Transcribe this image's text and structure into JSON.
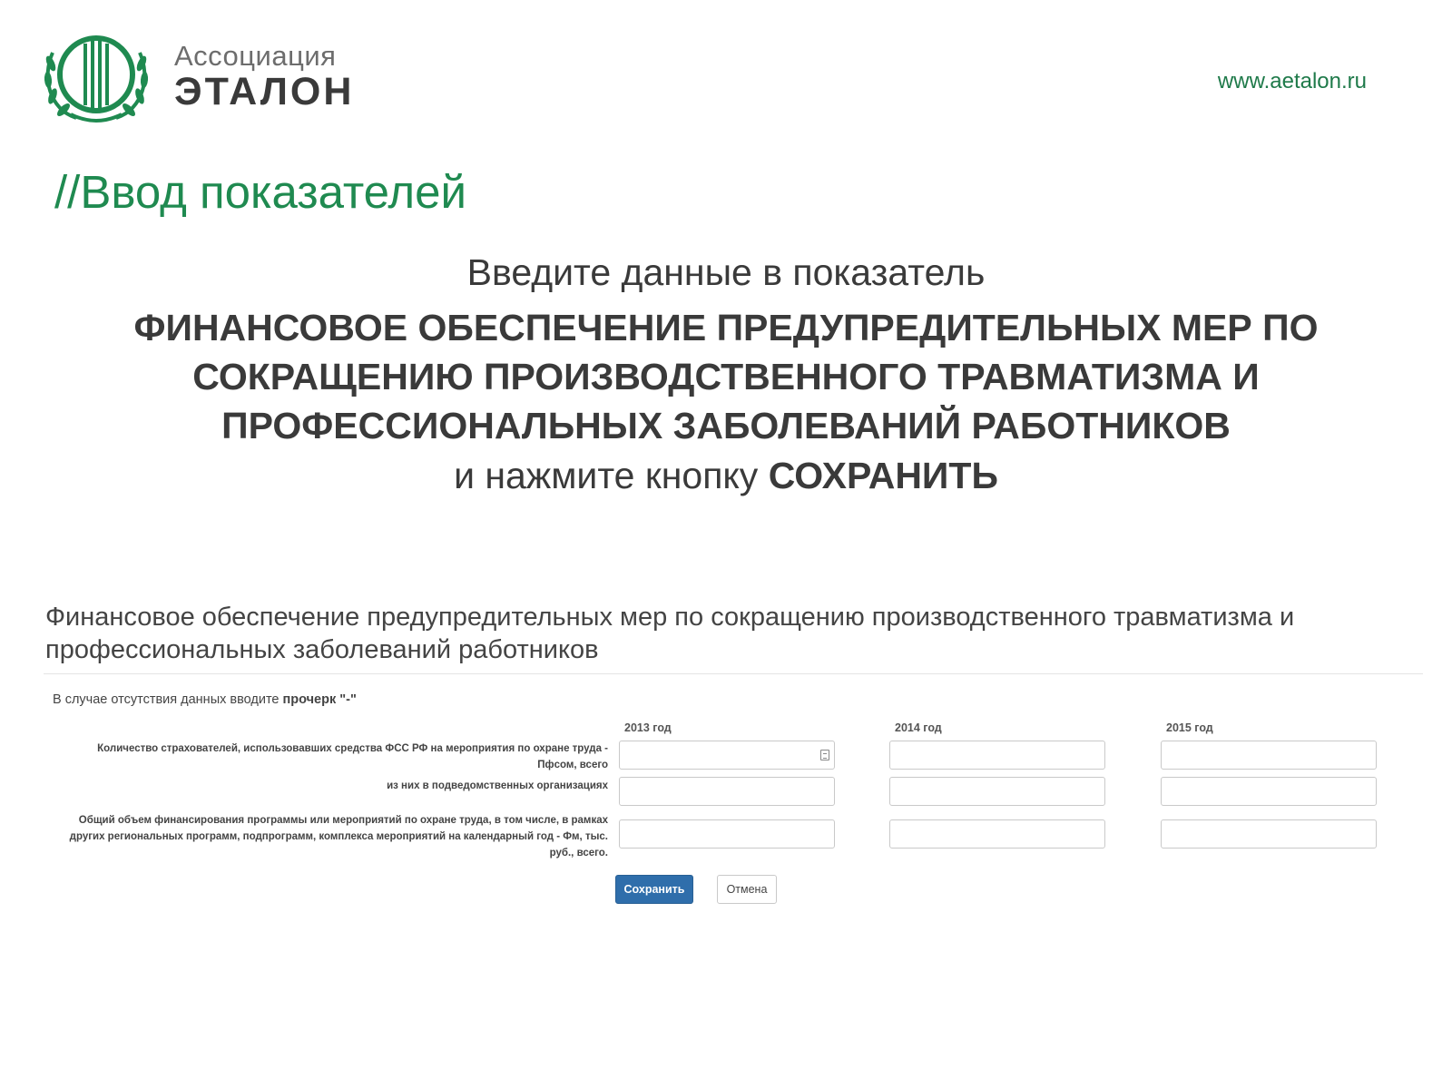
{
  "header": {
    "brand_line1": "Ассоциация",
    "brand_line2": "ЭТАЛОН",
    "site_url": "www.aetalon.ru",
    "logo_icon": "laurel-wreath-logo-icon",
    "brand_color": "#1f8a50"
  },
  "slide": {
    "title": "//Ввод показателей"
  },
  "instruction": {
    "lead": "Введите данные в показатель",
    "indicator": "ФИНАНСОВОЕ ОБЕСПЕЧЕНИЕ ПРЕДУПРЕДИТЕЛЬНЫХ МЕР ПО СОКРАЩЕНИЮ ПРОИЗВОДСТВЕННОГО ТРАВМАТИЗМА И ПРОФЕССИОНАЛЬНЫХ ЗАБОЛЕВАНИЙ РАБОТНИКОВ",
    "action_prefix": "и нажмите кнопку ",
    "action_button": "СОХРАНИТЬ"
  },
  "form": {
    "heading": "Финансовое обеспечение предупредительных мер по сокращению производственного травматизма и профессиональных заболеваний работников",
    "hint_prefix": "В случае отсутствия данных вводите ",
    "hint_bold": "прочерк \"-\"",
    "columns": [
      "2013 год",
      "2014 год",
      "2015 год"
    ],
    "rows": [
      {
        "label": "Количество страхователей, использовавших средства ФСС РФ на мероприятия по охране труда - Пфсом, всего",
        "values": [
          "",
          "",
          ""
        ]
      },
      {
        "label": "из них в подведомственных организациях",
        "values": [
          "",
          "",
          ""
        ]
      },
      {
        "label": "Общий объем финансирования программы или мероприятий по охране труда, в том числе, в рамках других региональных программ, подпрограмм, комплекса мероприятий на календарный год - Фм, тыс. руб., всего.",
        "values": [
          "",
          "",
          ""
        ]
      }
    ],
    "save_label": "Сохранить",
    "cancel_label": "Отмена",
    "save_color": "#2f6eab"
  }
}
